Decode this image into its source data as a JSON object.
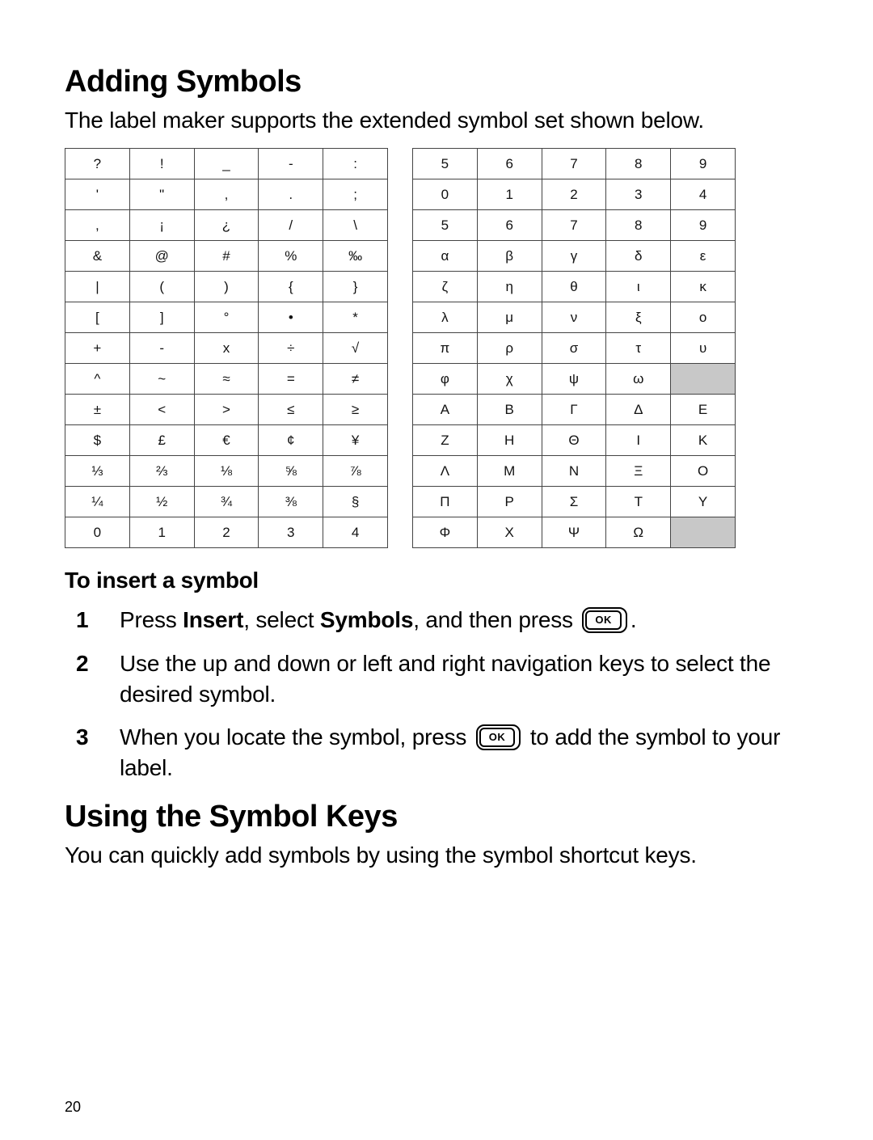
{
  "page_number": "20",
  "section_heading": "Adding Symbols",
  "intro_text": "The label maker supports the extended symbol set shown below.",
  "left_table": [
    [
      "?",
      "!",
      "_",
      "-",
      ":"
    ],
    [
      "'",
      "\"",
      ",",
      ".",
      ";"
    ],
    [
      ",",
      "¡",
      "¿",
      "/",
      "\\"
    ],
    [
      "&",
      "@",
      "#",
      "%",
      "‰"
    ],
    [
      "|",
      "(",
      ")",
      "{",
      "}"
    ],
    [
      "[",
      "]",
      "°",
      "•",
      "*"
    ],
    [
      "+",
      "-",
      "x",
      "÷",
      "√"
    ],
    [
      "^",
      "~",
      "≈",
      "=",
      "≠"
    ],
    [
      "±",
      "<",
      ">",
      "≤",
      "≥"
    ],
    [
      "$",
      "£",
      "€",
      "¢",
      "¥"
    ],
    [
      "⅓",
      "⅔",
      "⅛",
      "⅝",
      "⅞"
    ],
    [
      "¼",
      "½",
      "¾",
      "⅜",
      "§"
    ],
    [
      "0",
      "1",
      "2",
      "3",
      "4"
    ]
  ],
  "right_table": [
    [
      "5",
      "6",
      "7",
      "8",
      "9"
    ],
    [
      "0",
      "1",
      "2",
      "3",
      "4"
    ],
    [
      "5",
      "6",
      "7",
      "8",
      "9"
    ],
    [
      "α",
      "β",
      "γ",
      "δ",
      "ε"
    ],
    [
      "ζ",
      "η",
      "θ",
      "ι",
      "κ"
    ],
    [
      "λ",
      "μ",
      "ν",
      "ξ",
      "ο"
    ],
    [
      "π",
      "ρ",
      "σ",
      "τ",
      "υ"
    ],
    [
      "φ",
      "χ",
      "ψ",
      "ω",
      ""
    ],
    [
      "Α",
      "Β",
      "Γ",
      "Δ",
      "Ε"
    ],
    [
      "Ζ",
      "Η",
      "Θ",
      "Ι",
      "Κ"
    ],
    [
      "Λ",
      "Μ",
      "Ν",
      "Ξ",
      "Ο"
    ],
    [
      "Π",
      "Ρ",
      "Σ",
      "Τ",
      "Υ"
    ],
    [
      "Φ",
      "Χ",
      "Ψ",
      "Ω",
      ""
    ]
  ],
  "right_table_shaded": [
    [
      7,
      4
    ],
    [
      12,
      4
    ]
  ],
  "sub_heading": "To insert a symbol",
  "steps": [
    {
      "num": "1",
      "pre": "Press ",
      "bold1": "Insert",
      "mid1": ", select ",
      "bold2": "Symbols",
      "mid2": ", and then press ",
      "ok": true,
      "post": "."
    },
    {
      "num": "2",
      "plain": "Use the up and down or left and right navigation keys to select the desired symbol."
    },
    {
      "num": "3",
      "pre": "When you locate the symbol, press ",
      "ok": true,
      "post": " to add the symbol to your label."
    }
  ],
  "ok_button_label": "OK",
  "section_heading_2": "Using the Symbol Keys",
  "intro_text_2": "You can quickly add symbols by using the symbol shortcut keys."
}
